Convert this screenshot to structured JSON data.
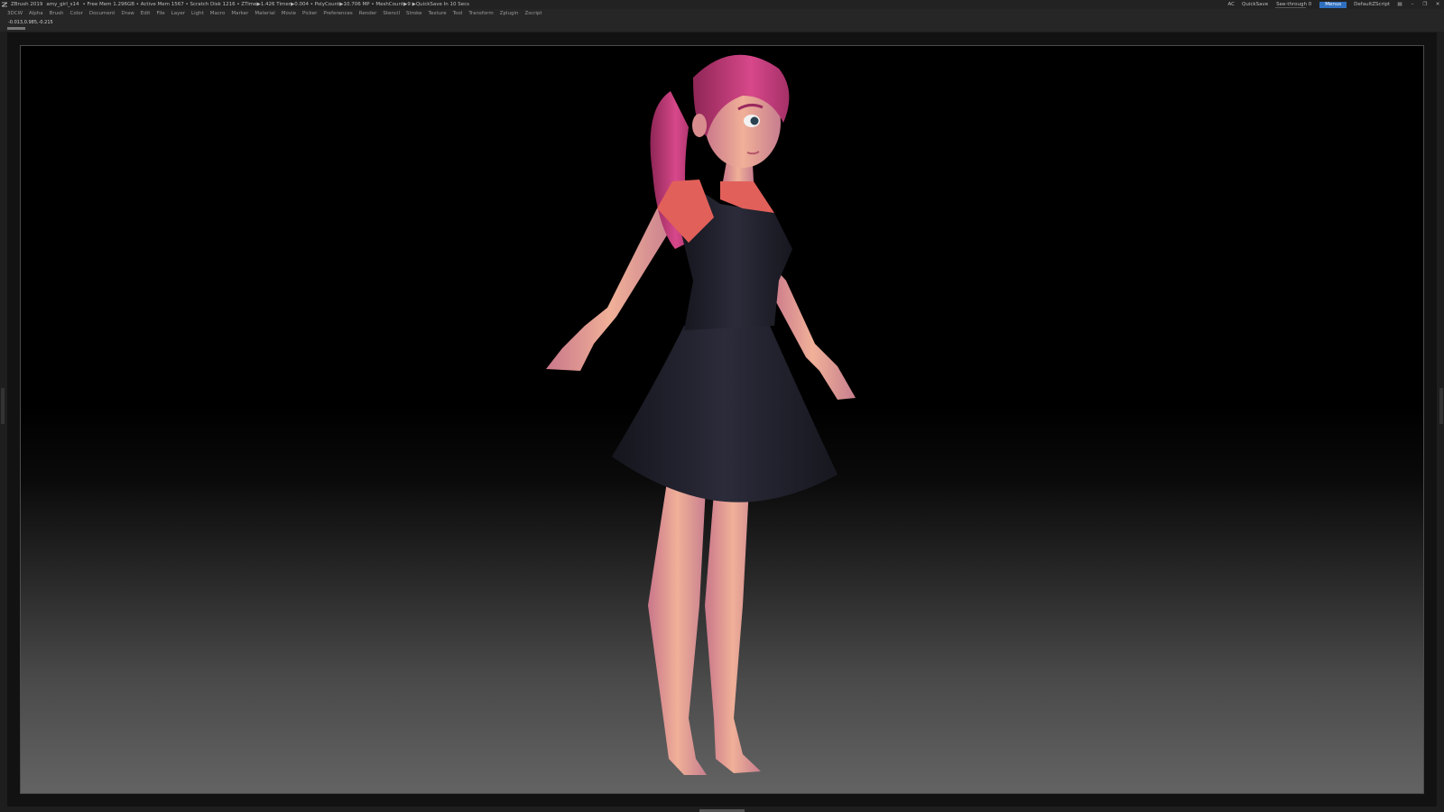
{
  "titlebar": {
    "app_name": "ZBrush 2019",
    "file_name": "amy_girl_s14",
    "status": "• Free Mem 1.296GB • Active Mem 1567 • Scratch Disk 1216 • ZTime▶1.426 Timer▶0.004 • PolyCount▶10.706 MP • MeshCount▶9 ▶QuickSave In 10 Secs",
    "ac_label": "AC",
    "quicksave_label": "QuickSave",
    "see_through_label": "See-through",
    "see_through_value": "0",
    "see_through_level": 0,
    "menus_label": "Menus",
    "script_label": "DefaultZScript"
  },
  "menubar": {
    "items": [
      "3DCW",
      "Alpha",
      "Brush",
      "Color",
      "Document",
      "Draw",
      "Edit",
      "File",
      "Layer",
      "Light",
      "Macro",
      "Marker",
      "Material",
      "Movie",
      "Picker",
      "Preferences",
      "Render",
      "Stencil",
      "Stroke",
      "Texture",
      "Tool",
      "Transform",
      "Zplugin",
      "Zscript"
    ]
  },
  "coordbar": {
    "coords": "-0.013,0.985,-0.215"
  },
  "colors": {
    "menus_accent": "#2f6fc0",
    "hair": "#c23a78",
    "skin": "#e8a38f",
    "dress": "#23232f",
    "shirt": "#e2605a"
  },
  "icons": {
    "app": "zbrush-logo-icon",
    "window_controls": [
      "layout-icon",
      "minimize-icon",
      "restore-icon",
      "close-icon"
    ]
  }
}
